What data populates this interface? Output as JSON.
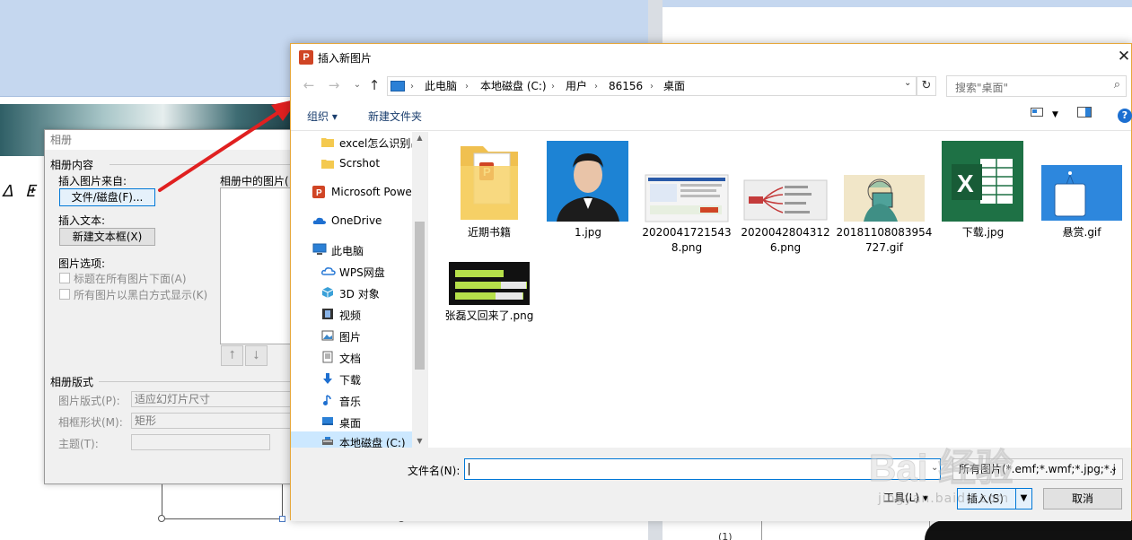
{
  "album": {
    "title": "相册",
    "content_group": "相册内容",
    "insert_from": "插入图片来自:",
    "file_disk_button": "文件/磁盘(F)...",
    "pictures_in_album": "相册中的图片(",
    "insert_text": "插入文本:",
    "new_textbox_button": "新建文本框(X)",
    "picture_options": "图片选项:",
    "caption_below": "标题在所有图片下面(A)",
    "all_black_white": "所有图片以黑白方式显示(K)",
    "layout_group": "相册版式",
    "picture_layout_label": "图片版式(P):",
    "picture_layout_value": "适应幻灯片尺寸",
    "frame_shape_label": "相框形状(M):",
    "frame_shape_value": "矩形",
    "theme_label": "主题(T):"
  },
  "dialog": {
    "title": "插入新图片",
    "close_glyph": "✕",
    "breadcrumb": [
      "此电脑",
      "本地磁盘 (C:)",
      "用户",
      "86156",
      "桌面"
    ],
    "search_placeholder": "搜索\"桌面\"",
    "organize_label": "组织 ▾",
    "new_folder_label": "新建文件夹",
    "sidebar_items": [
      {
        "label": "excel怎么识别出",
        "icon": "folder-icon"
      },
      {
        "label": "Scrshot",
        "icon": "folder-icon"
      },
      {
        "label": "Microsoft Powe",
        "icon": "powerpoint-icon"
      },
      {
        "label": "OneDrive",
        "icon": "onedrive-icon"
      },
      {
        "label": "此电脑",
        "icon": "computer-icon"
      },
      {
        "label": "WPS网盘",
        "icon": "cloud-icon"
      },
      {
        "label": "3D 对象",
        "icon": "cube-icon"
      },
      {
        "label": "视频",
        "icon": "video-icon"
      },
      {
        "label": "图片",
        "icon": "pictures-icon"
      },
      {
        "label": "文档",
        "icon": "documents-icon"
      },
      {
        "label": "下载",
        "icon": "download-icon"
      },
      {
        "label": "音乐",
        "icon": "music-icon"
      },
      {
        "label": "桌面",
        "icon": "desktop-icon"
      },
      {
        "label": "本地磁盘 (C:)",
        "icon": "drive-icon"
      }
    ],
    "files": [
      {
        "name": "近期书籍",
        "kind": "folder"
      },
      {
        "name": "1.jpg",
        "kind": "portrait"
      },
      {
        "name": "20200417215438.png",
        "kind": "screenshot"
      },
      {
        "name": "20200428043126.png",
        "kind": "mindmap"
      },
      {
        "name": "20181108083954727.gif",
        "kind": "illustration"
      },
      {
        "name": "下载.jpg",
        "kind": "excel-logo"
      },
      {
        "name": "悬赏.gif",
        "kind": "sign"
      },
      {
        "name": "张磊又回来了.png",
        "kind": "green-bars"
      }
    ],
    "filename_label": "文件名(N):",
    "filename_value": "",
    "filetype_value": "所有图片(*.emf;*.wmf;*.jpg;*.j",
    "tools_label": "工具(L) ▾",
    "insert_label": "插入(S)",
    "cancel_label": "取消"
  },
  "background": {
    "page_number": "(1)",
    "watermark": "Bai 经验",
    "watermark_sub": "jingyan.baidu.com"
  },
  "colors": {
    "accent": "#0078d7",
    "selection": "#cce8ff",
    "dialog_border": "#e6a73a",
    "annotation_arrow": "#e02020"
  }
}
